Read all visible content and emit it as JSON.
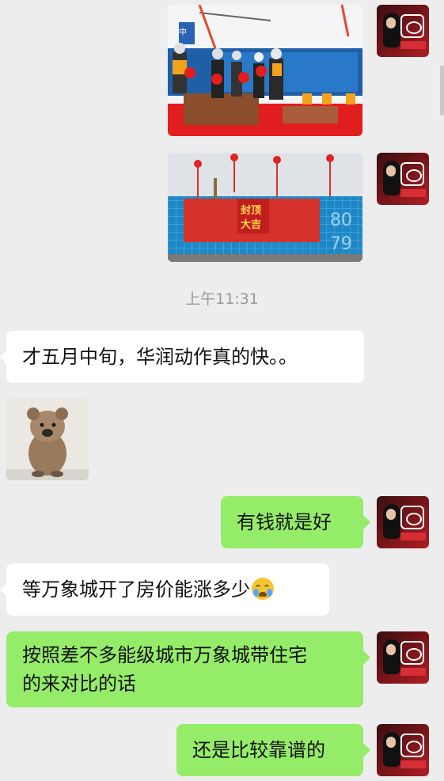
{
  "chat": {
    "timestamp": "上午11:31",
    "photo1": {
      "banner": "中",
      "scene": "groundbreaking ceremony"
    },
    "photo2": {
      "sign_line1": "封顶",
      "sign_line2": "大吉",
      "digits1": "80",
      "digits2": "79"
    },
    "messages": [
      {
        "side": "left",
        "text": "才五月中旬，华润动作真的快。。"
      },
      {
        "side": "right",
        "text": "有钱就是好"
      },
      {
        "side": "left",
        "text": "等万象城开了房价能涨多少"
      },
      {
        "side": "right",
        "line1": "按照差不多能级城市万象城带住宅",
        "line2": "的来对比的话"
      },
      {
        "side": "right",
        "text": "还是比较靠谱的"
      }
    ]
  },
  "colors": {
    "background": "#ededed",
    "self_bubble": "#95ec69",
    "other_bubble": "#ffffff",
    "timestamp": "#9a9a9a"
  },
  "icons": [
    "avatar",
    "crying-laughing-emoji",
    "quokka-sticker"
  ]
}
